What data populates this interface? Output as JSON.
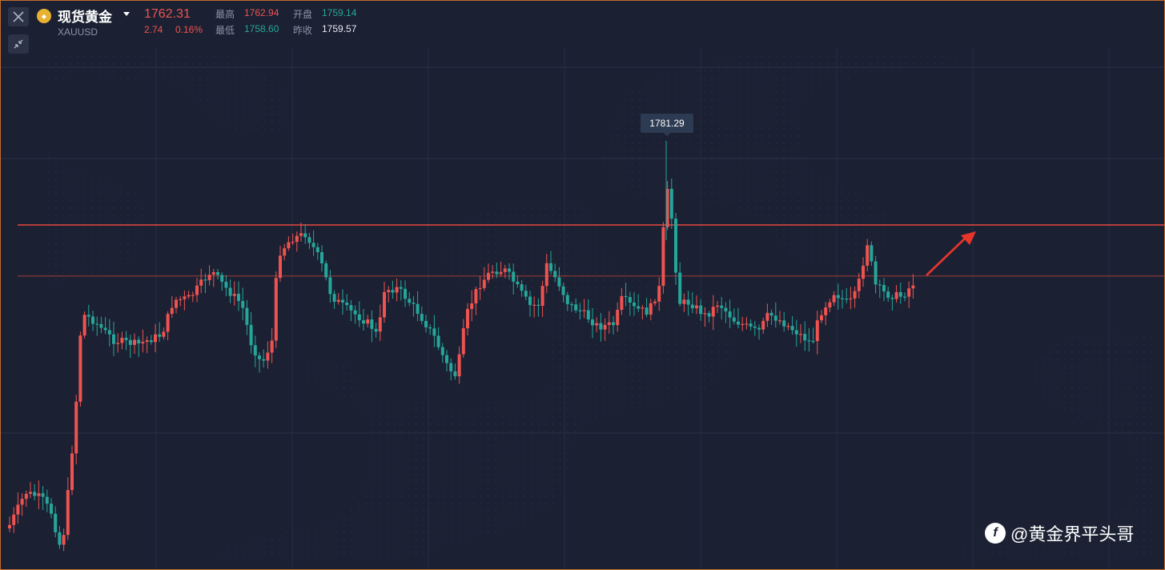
{
  "instrument": {
    "name": "现货黄金",
    "symbol": "XAUUSD",
    "price": "1762.31",
    "change": "2.74",
    "change_pct": "0.16%"
  },
  "stats": {
    "high_label": "最高",
    "high": "1762.94",
    "open_label": "开盘",
    "open": "1759.14",
    "low_label": "最低",
    "low": "1758.60",
    "prev_close_label": "昨收",
    "prev_close": "1759.57"
  },
  "tooltip": {
    "value": "1781.29"
  },
  "watermark": {
    "text": "@黄金界平头哥"
  },
  "colors": {
    "background": "#1b2133",
    "up": "#ef5350",
    "down": "#26a69a",
    "resistance_line": "#e8483c",
    "arrow": "#e8352c"
  },
  "icons": {
    "close": "close-icon",
    "collapse": "collapse-icon",
    "coin": "gold-coin-icon",
    "dropdown": "caret-down-icon"
  },
  "chart_data": {
    "type": "candlestick",
    "reference_lines": [
      1774,
      1768.5
    ],
    "peak_annotation": 1781.29,
    "trend_arrow": "up-right"
  }
}
